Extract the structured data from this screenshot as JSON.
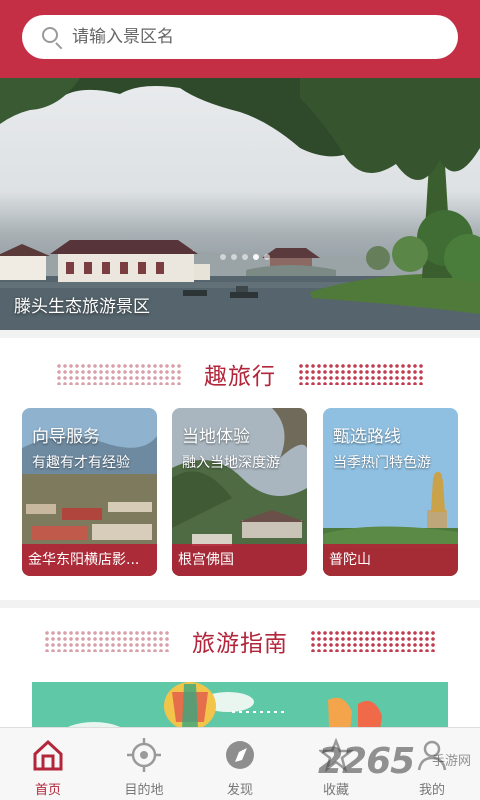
{
  "search": {
    "placeholder": "请输入景区名"
  },
  "banner": {
    "caption": "滕头生态旅游景区",
    "dots_total": 5,
    "active_dot": 4
  },
  "section_trip": {
    "title": "趣旅行",
    "cards": [
      {
        "title": "向导服务",
        "subtitle": "有趣有才有经验",
        "place": "金华东阳横店影..."
      },
      {
        "title": "当地体验",
        "subtitle": "融入当地深度游",
        "place": "根宫佛国"
      },
      {
        "title": "甄选路线",
        "subtitle": "当季热门特色游",
        "place": "普陀山"
      }
    ]
  },
  "section_guide": {
    "title": "旅游指南"
  },
  "tabbar": {
    "tabs": [
      {
        "label": "首页",
        "icon": "home-icon",
        "active": true
      },
      {
        "label": "目的地",
        "icon": "target-icon",
        "active": false
      },
      {
        "label": "发现",
        "icon": "compass-icon",
        "active": false
      },
      {
        "label": "收藏",
        "icon": "star-icon",
        "active": false
      },
      {
        "label": "我的",
        "icon": "user-icon",
        "active": false
      }
    ]
  },
  "watermark": {
    "text": "2265",
    "suffix": "手游网"
  },
  "colors": {
    "brand": "#c42f45",
    "accent": "#b2253a"
  }
}
